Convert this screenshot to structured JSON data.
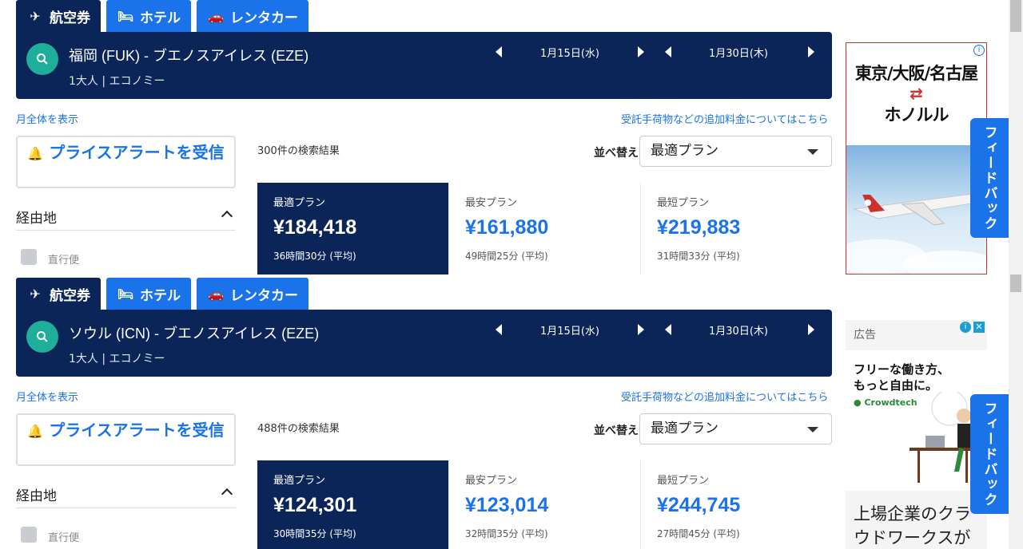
{
  "tabs": [
    {
      "label": "航空券",
      "icon": "plane-icon"
    },
    {
      "label": "ホテル",
      "icon": "bed-icon"
    },
    {
      "label": "レンタカー",
      "icon": "car-icon"
    }
  ],
  "common": {
    "month_link": "月全体を表示",
    "fees_link": "受託手荷物などの追加料金についてはこちら",
    "alert_button": "プライスアラートを受信",
    "section_via": "経由地",
    "direct_label": "直行便",
    "sort_label": "並べ替え",
    "sort_value": "最適プラン",
    "feedback": "フィードバック",
    "date_out": "1月15日(水)",
    "date_ret": "1月30日(木)",
    "pax": "1大人 | エコノミー",
    "card_titles": [
      "最適プラン",
      "最安プラン",
      "最短プラン"
    ]
  },
  "searches": [
    {
      "route": "福岡 (FUK) - ブエノスアイレス (EZE)",
      "count": "300件の検索結果",
      "prices": [
        "¥184,418",
        "¥161,880",
        "¥219,883"
      ],
      "durations": [
        "36時間30分 (平均)",
        "49時間25分 (平均)",
        "31時間33分 (平均)"
      ]
    },
    {
      "route": "ソウル (ICN) - ブエノスアイレス (EZE)",
      "count": "488件の検索結果",
      "prices": [
        "¥124,301",
        "¥123,014",
        "¥244,745"
      ],
      "durations": [
        "30時間35分 (平均)",
        "32時間35分 (平均)",
        "27時間45分 (平均)"
      ]
    }
  ],
  "ads": {
    "ad1_headline": "東京/大阪/名古屋",
    "ad1_dest": "ホノルル",
    "ad2_label": "広告",
    "ad2_tagline_1": "フリーな働き方、",
    "ad2_tagline_2": "もっと自由に。",
    "ad2_brand": "Crowdtech",
    "ad2_big_1": "上場企業のクラ",
    "ad2_big_2": "ウドワークスが"
  },
  "colors": {
    "navy": "#0b2559",
    "blue": "#1a73e8",
    "teal": "#1fae9a"
  }
}
